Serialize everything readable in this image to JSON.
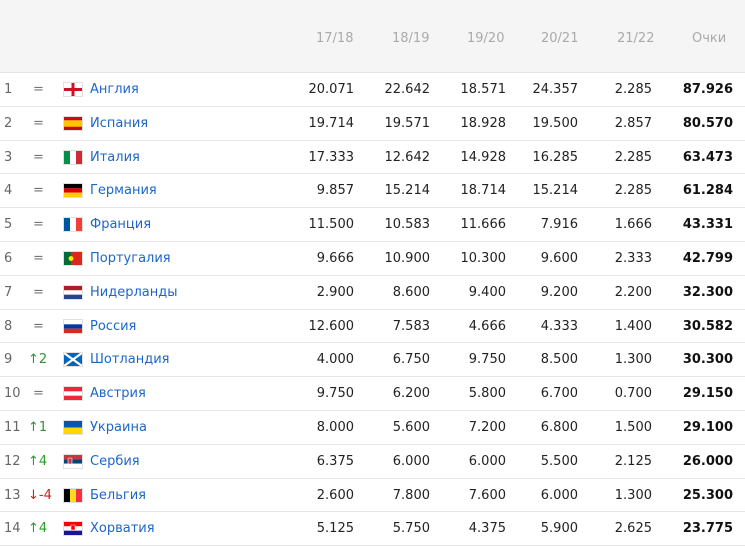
{
  "header": {
    "season1": "17/18",
    "season2": "18/19",
    "season3": "19/20",
    "season4": "20/21",
    "season5": "21/22",
    "total": "Очки"
  },
  "rows": [
    {
      "rank": "1",
      "move": "=",
      "move_type": "eq",
      "country": "Англия",
      "flag": "england",
      "s1": "20.071",
      "s2": "22.642",
      "s3": "18.571",
      "s4": "24.357",
      "s5": "2.285",
      "total": "87.926"
    },
    {
      "rank": "2",
      "move": "=",
      "move_type": "eq",
      "country": "Испания",
      "flag": "spain",
      "s1": "19.714",
      "s2": "19.571",
      "s3": "18.928",
      "s4": "19.500",
      "s5": "2.857",
      "total": "80.570"
    },
    {
      "rank": "3",
      "move": "=",
      "move_type": "eq",
      "country": "Италия",
      "flag": "italy",
      "s1": "17.333",
      "s2": "12.642",
      "s3": "14.928",
      "s4": "16.285",
      "s5": "2.285",
      "total": "63.473"
    },
    {
      "rank": "4",
      "move": "=",
      "move_type": "eq",
      "country": "Германия",
      "flag": "germany",
      "s1": "9.857",
      "s2": "15.214",
      "s3": "18.714",
      "s4": "15.214",
      "s5": "2.285",
      "total": "61.284"
    },
    {
      "rank": "5",
      "move": "=",
      "move_type": "eq",
      "country": "Франция",
      "flag": "france",
      "s1": "11.500",
      "s2": "10.583",
      "s3": "11.666",
      "s4": "7.916",
      "s5": "1.666",
      "total": "43.331"
    },
    {
      "rank": "6",
      "move": "=",
      "move_type": "eq",
      "country": "Португалия",
      "flag": "portugal",
      "s1": "9.666",
      "s2": "10.900",
      "s3": "10.300",
      "s4": "9.600",
      "s5": "2.333",
      "total": "42.799"
    },
    {
      "rank": "7",
      "move": "=",
      "move_type": "eq",
      "country": "Нидерланды",
      "flag": "netherlands",
      "s1": "2.900",
      "s2": "8.600",
      "s3": "9.400",
      "s4": "9.200",
      "s5": "2.200",
      "total": "32.300"
    },
    {
      "rank": "8",
      "move": "=",
      "move_type": "eq",
      "country": "Россия",
      "flag": "russia",
      "s1": "12.600",
      "s2": "7.583",
      "s3": "4.666",
      "s4": "4.333",
      "s5": "1.400",
      "total": "30.582"
    },
    {
      "rank": "9",
      "move": "↑2",
      "move_type": "up",
      "country": "Шотландия",
      "flag": "scotland",
      "s1": "4.000",
      "s2": "6.750",
      "s3": "9.750",
      "s4": "8.500",
      "s5": "1.300",
      "total": "30.300"
    },
    {
      "rank": "10",
      "move": "=",
      "move_type": "eq",
      "country": "Австрия",
      "flag": "austria",
      "s1": "9.750",
      "s2": "6.200",
      "s3": "5.800",
      "s4": "6.700",
      "s5": "0.700",
      "total": "29.150"
    },
    {
      "rank": "11",
      "move": "↑1",
      "move_type": "up",
      "country": "Украина",
      "flag": "ukraine",
      "s1": "8.000",
      "s2": "5.600",
      "s3": "7.200",
      "s4": "6.800",
      "s5": "1.500",
      "total": "29.100"
    },
    {
      "rank": "12",
      "move": "↑4",
      "move_type": "up",
      "country": "Сербия",
      "flag": "serbia",
      "s1": "6.375",
      "s2": "6.000",
      "s3": "6.000",
      "s4": "5.500",
      "s5": "2.125",
      "total": "26.000"
    },
    {
      "rank": "13",
      "move": "↓-4",
      "move_type": "down",
      "country": "Бельгия",
      "flag": "belgium",
      "s1": "2.600",
      "s2": "7.800",
      "s3": "7.600",
      "s4": "6.000",
      "s5": "1.300",
      "total": "25.300"
    },
    {
      "rank": "14",
      "move": "↑4",
      "move_type": "up",
      "country": "Хорватия",
      "flag": "croatia",
      "s1": "5.125",
      "s2": "5.750",
      "s3": "4.375",
      "s4": "5.900",
      "s5": "2.625",
      "total": "23.775"
    }
  ]
}
